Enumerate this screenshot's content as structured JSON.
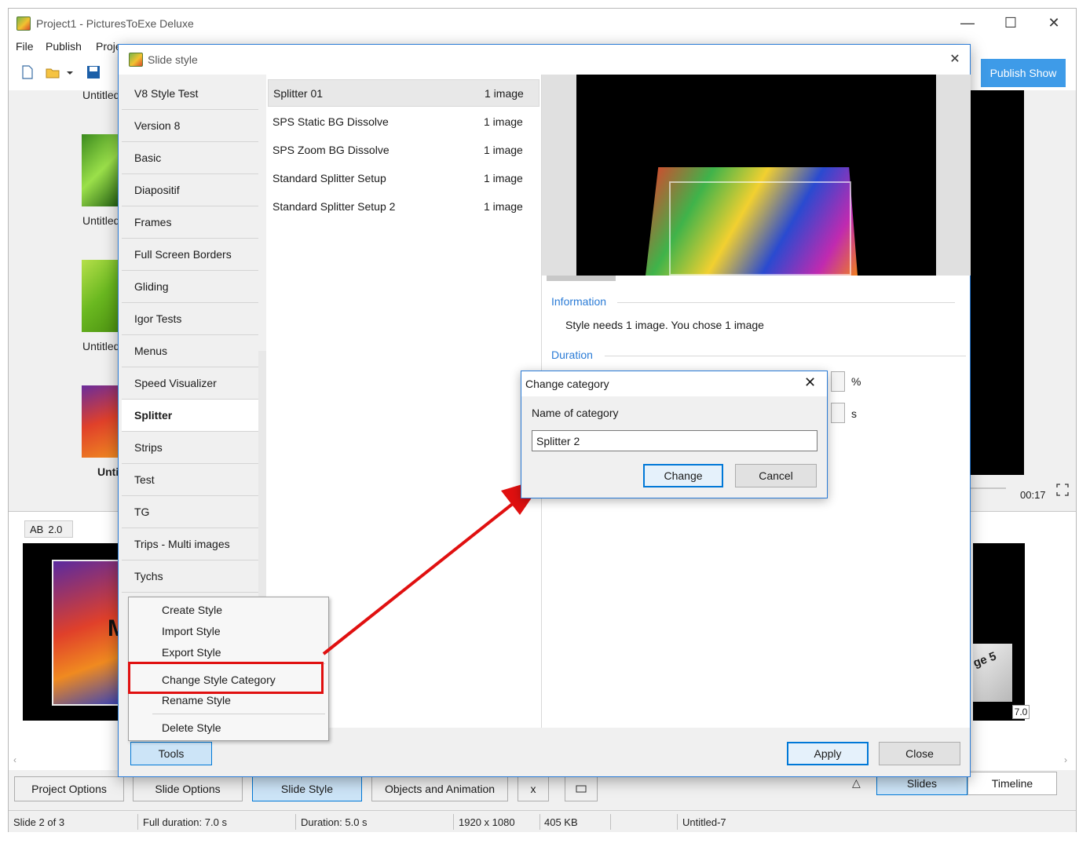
{
  "app": {
    "title": "Project1 - PicturesToExe Deluxe",
    "menu": [
      "File",
      "Publish",
      "Proje"
    ],
    "publish_label": "Publish Show",
    "thumb_labels": [
      "Untitled",
      "Untitled",
      "Untitled",
      "Untitled",
      "Unti"
    ],
    "time": "00:17",
    "ab_label": "AB",
    "ab_value": "2.0",
    "slide_value": "7.0",
    "slide_thumb_text": "M",
    "slide_thumb_right_text": "ge 5"
  },
  "bottom_buttons": {
    "project_options": "Project Options",
    "slide_options": "Slide Options",
    "slide_style": "Slide Style",
    "objects_animation": "Objects and Animation",
    "x": "x",
    "slides": "Slides",
    "timeline": "Timeline",
    "triangle": "△"
  },
  "status": {
    "slide": "Slide 2 of 3",
    "full_duration": "Full duration: 7.0 s",
    "duration": "Duration: 5.0 s",
    "resolution": "1920 x 1080",
    "size": "405 KB",
    "name": "Untitled-7"
  },
  "style_dialog": {
    "title": "Slide style",
    "categories": [
      "V8 Style Test",
      "Version 8",
      "Basic",
      "Diapositif",
      "Frames",
      "Full Screen Borders",
      "Gliding",
      "Igor Tests",
      "Menus",
      "Speed Visualizer",
      "Splitter",
      "Strips",
      "Test",
      "TG",
      "Trips - Multi images",
      "Tychs"
    ],
    "selected_category": "Splitter",
    "styles": [
      {
        "name": "Splitter 01",
        "count": "1 image"
      },
      {
        "name": "SPS Static BG Dissolve",
        "count": "1 image"
      },
      {
        "name": "SPS Zoom BG Dissolve",
        "count": "1 image"
      },
      {
        "name": "Standard Splitter Setup",
        "count": "1 image"
      },
      {
        "name": "Standard Splitter Setup 2",
        "count": "1 image"
      }
    ],
    "information_title": "Information",
    "information_text": "Style needs 1 image. You chose 1 image",
    "duration_title": "Duration",
    "percent_unit": "%",
    "seconds_unit": "s",
    "tools_label": "Tools",
    "apply_label": "Apply",
    "close_label": "Close"
  },
  "tools_menu": {
    "create": "Create Style",
    "import": "Import Style",
    "export": "Export Style",
    "change_category": "Change Style Category",
    "rename": "Rename Style",
    "delete": "Delete Style"
  },
  "change_category_dialog": {
    "title": "Change category",
    "field_label": "Name of category",
    "value": "Splitter 2",
    "change_label": "Change",
    "cancel_label": "Cancel"
  },
  "colors": {
    "accent": "#0078d7",
    "annotation_red": "#e01010",
    "section_blue": "#2a7bd6"
  }
}
